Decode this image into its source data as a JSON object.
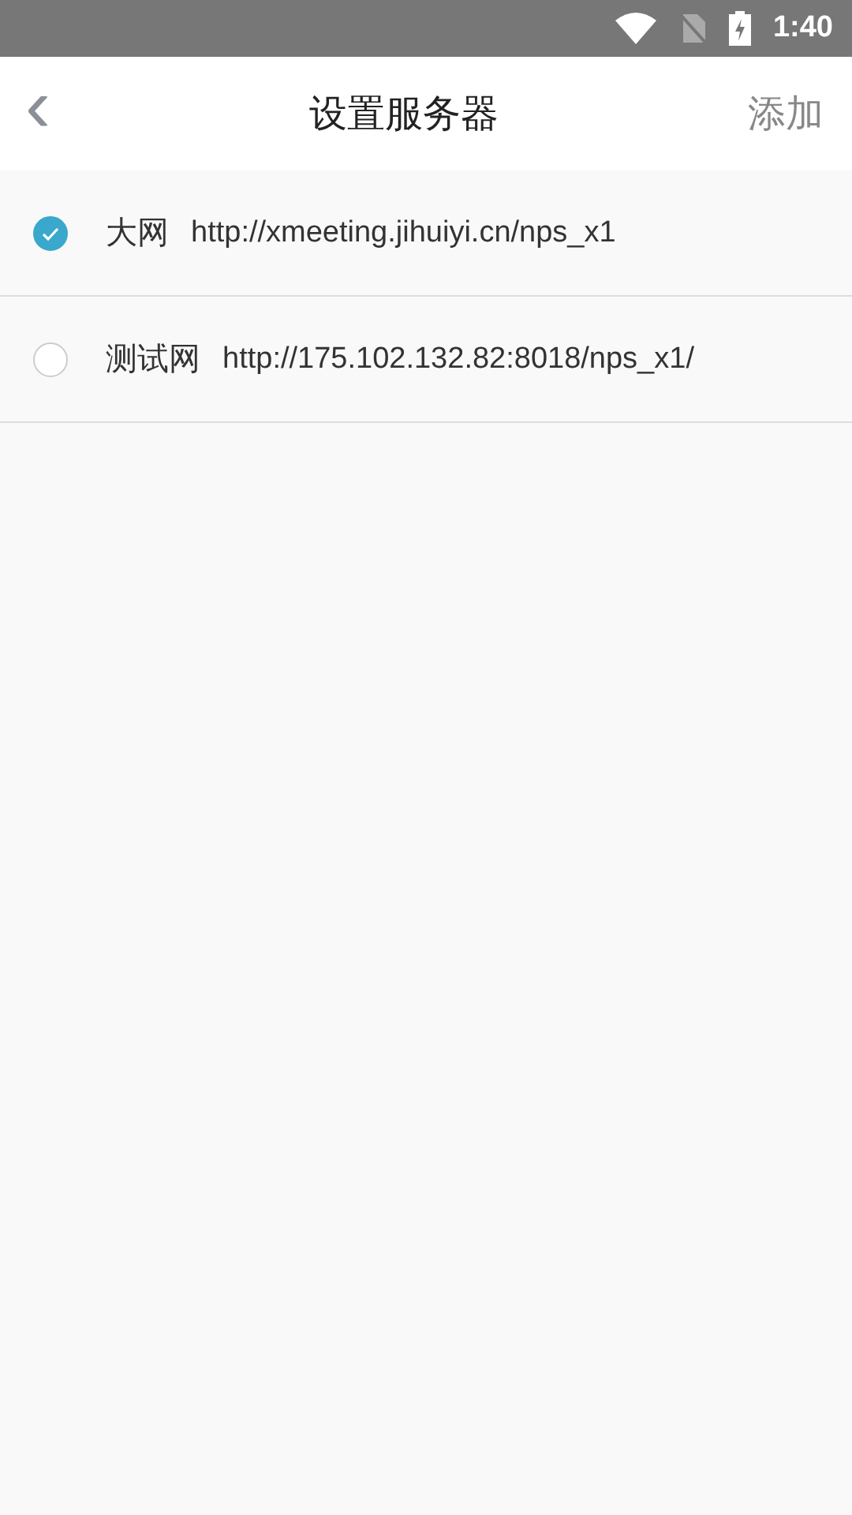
{
  "status_bar": {
    "time": "1:40"
  },
  "header": {
    "back": "‹",
    "title": "设置服务器",
    "action": "添加"
  },
  "servers": [
    {
      "name": "大网",
      "url": "http://xmeeting.jihuiyi.cn/nps_x1",
      "selected": true
    },
    {
      "name": "测试网",
      "url": "http://175.102.132.82:8018/nps_x1/",
      "selected": false
    }
  ]
}
